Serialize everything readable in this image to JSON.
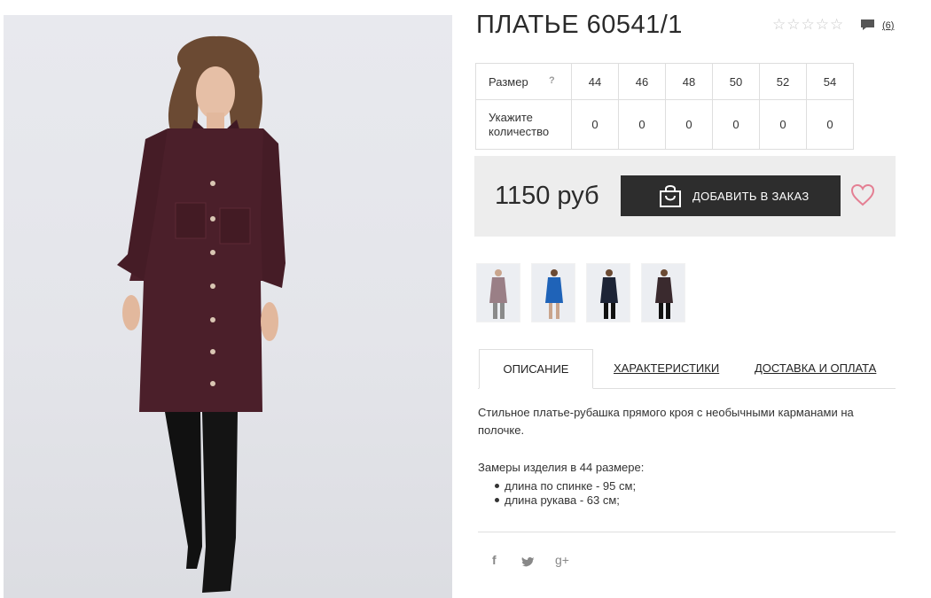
{
  "product": {
    "title": "ПЛАТЬЕ 60541/1",
    "rating_stars": [
      "☆",
      "☆",
      "☆",
      "☆",
      "☆"
    ],
    "rating_value": 0,
    "review_count": "(6)",
    "photo_icon": "dress-model-photo"
  },
  "sizes": {
    "label": "Размер",
    "help": "?",
    "values": [
      "44",
      "46",
      "48",
      "50",
      "52",
      "54"
    ],
    "quantity_label": "Укажите количество",
    "quantities": [
      "0",
      "0",
      "0",
      "0",
      "0",
      "0"
    ]
  },
  "order": {
    "price": "1150 руб",
    "add_button": "ДОБАВИТЬ В ЗАКАЗ",
    "bag_icon": "shopping-bag-icon",
    "wishlist_icon": "heart-icon"
  },
  "thumbnails": [
    {
      "color": "#9a7f86"
    },
    {
      "color": "#1f63b8"
    },
    {
      "color": "#1d2436"
    },
    {
      "color": "#3a2a2e"
    }
  ],
  "tabs": [
    {
      "label": "ОПИСАНИЕ",
      "active": true
    },
    {
      "label": "ХАРАКТЕРИСТИКИ",
      "active": false
    },
    {
      "label": "ДОСТАВКА И ОПЛАТА",
      "active": false
    }
  ],
  "description": {
    "text": "Стильное платье-рубашка прямого кроя с необычными карманами на полочке.",
    "measures_title": "Замеры изделия в 44 размере:",
    "measures": [
      "длина по спинке - 95 см;",
      "длина рукава - 63 см;"
    ]
  },
  "social": {
    "facebook": "f",
    "twitter": "twitter-bird",
    "google_plus": "g+"
  },
  "colors": {
    "dress": "#4b1f2a",
    "button_bg": "#2d2d2d",
    "price_bg": "#ededed",
    "heart": "#e47f93"
  }
}
